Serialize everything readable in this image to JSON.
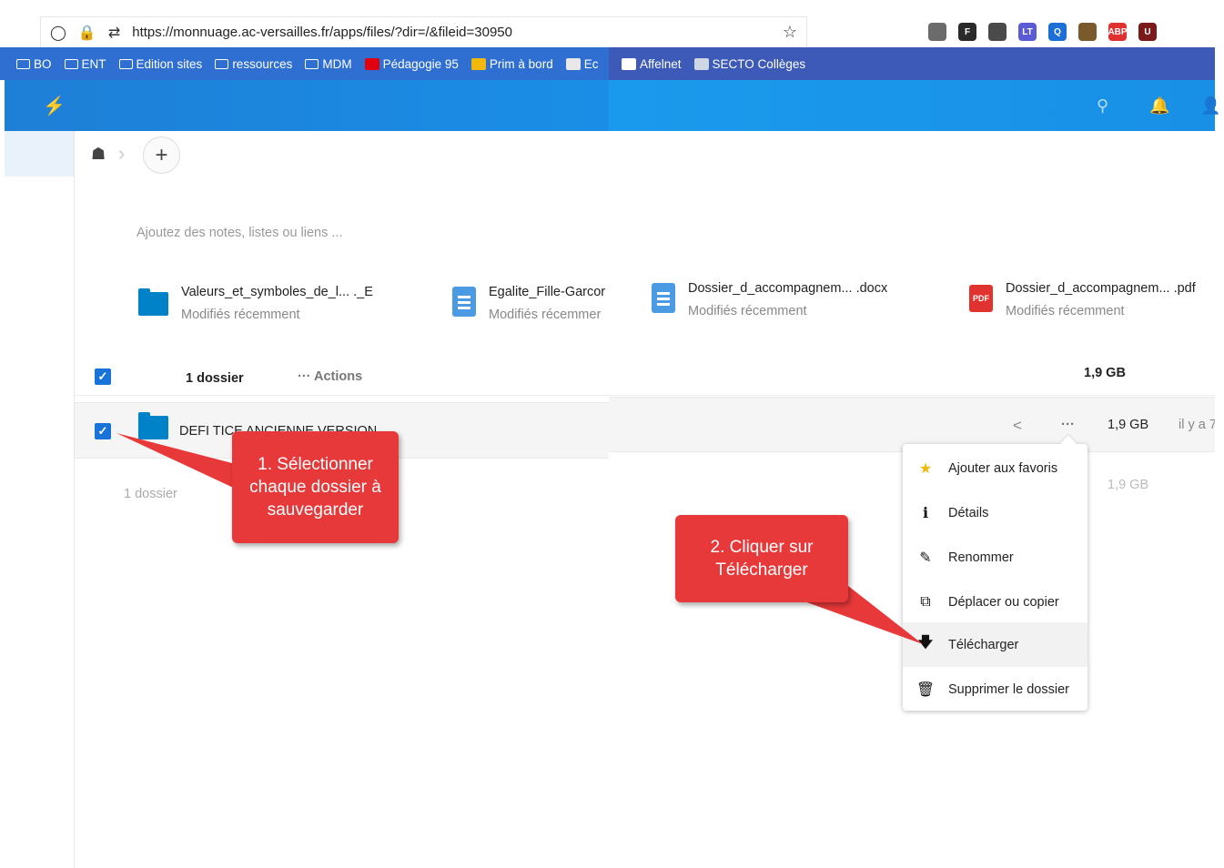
{
  "browser": {
    "url": "https://monnuage.ac-versailles.fr/apps/files/?dir=/&fileid=30950",
    "extensions": [
      {
        "label": "",
        "color": "#6b6b6b",
        "icon": "pocket-icon"
      },
      {
        "label": "F",
        "color": "#2a2a2a",
        "icon": "f-icon"
      },
      {
        "label": "",
        "color": "#4a4a4a",
        "icon": "ext-icon"
      },
      {
        "label": "LT",
        "color": "#5b5bd6",
        "icon": "languagetool-icon"
      },
      {
        "label": "Q",
        "color": "#1c6fd6",
        "icon": "q-icon"
      },
      {
        "label": "",
        "color": "#7a5a2a",
        "icon": "ext-icon"
      },
      {
        "label": "ABP",
        "color": "#e0302f",
        "icon": "adblock-icon"
      },
      {
        "label": "U",
        "color": "#7a1a1a",
        "icon": "ublock-icon"
      }
    ],
    "bookmarks_left": [
      {
        "label": "BO",
        "icon": "folder"
      },
      {
        "label": "ENT",
        "icon": "folder"
      },
      {
        "label": "Edition sites",
        "icon": "folder"
      },
      {
        "label": "ressources",
        "icon": "folder"
      },
      {
        "label": "MDM",
        "icon": "folder"
      },
      {
        "label": "Pédagogie 95",
        "icon": "marianne"
      },
      {
        "label": "Prim à bord",
        "icon": "prim"
      },
      {
        "label": "Ec",
        "icon": "ec"
      }
    ],
    "bookmarks_right": [
      {
        "label": "Affelnet",
        "icon": "affelnet"
      },
      {
        "label": "SECTO Collèges",
        "icon": "secto"
      }
    ]
  },
  "files": {
    "notes_placeholder": "Ajoutez des notes, listes ou liens ...",
    "recent": [
      {
        "name": "Valeurs_et_symboles_de_l... ._E",
        "sub": "Modifiés récemment",
        "type": "folder"
      },
      {
        "name": "Egalite_Fille-Garcor",
        "sub": "Modifiés récemmer",
        "type": "doc"
      },
      {
        "name": "Dossier_d_accompagnem... .docx",
        "sub": "Modifiés récemment",
        "type": "doc"
      },
      {
        "name": "Dossier_d_accompagnem... .pdf",
        "sub": "Modifiés récemment",
        "type": "pdf",
        "badge": "PDF"
      }
    ],
    "header": {
      "count": "1 dossier",
      "actions": "Actions",
      "size": "1,9 GB"
    },
    "row": {
      "name": "DEFI TICE ANCIENNE VERSION",
      "size": "1,9 GB",
      "modified": "il y a 7"
    },
    "footer": {
      "count": "1 dossier",
      "size": "1,9 GB"
    }
  },
  "menu": [
    {
      "label": "Ajouter aux favoris",
      "icon": "star-icon"
    },
    {
      "label": "Détails",
      "icon": "info-icon"
    },
    {
      "label": "Renommer",
      "icon": "pencil-icon"
    },
    {
      "label": "Déplacer ou copier",
      "icon": "move-icon"
    },
    {
      "label": "Télécharger",
      "icon": "download-icon"
    },
    {
      "label": "Supprimer le dossier",
      "icon": "trash-icon"
    }
  ],
  "callouts": {
    "one": "1. Sélectionner chaque dossier à sauvegarder",
    "two": "2. Cliquer sur Télécharger"
  },
  "colors": {
    "header": "#1a8ee6",
    "callout": "#e8393a",
    "checkbox": "#1a73d9"
  }
}
